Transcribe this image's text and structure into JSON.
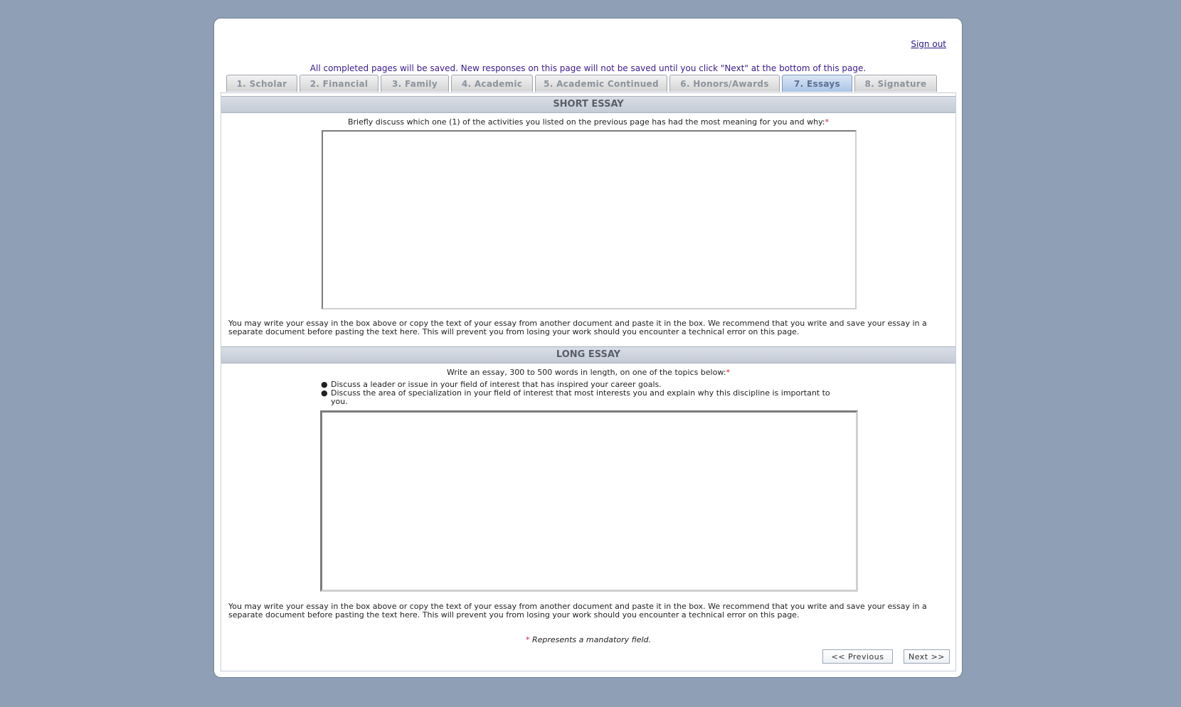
{
  "header": {
    "sign_out": "Sign out",
    "notice": "All completed pages will be saved. New responses on this page will not be saved until you click \"Next\" at the bottom of this page."
  },
  "tabs": [
    {
      "label": "1. Scholar",
      "active": false
    },
    {
      "label": "2. Financial",
      "active": false
    },
    {
      "label": "3. Family",
      "active": false
    },
    {
      "label": "4. Academic",
      "active": false
    },
    {
      "label": "5. Academic Continued",
      "active": false
    },
    {
      "label": "6. Honors/Awards",
      "active": false
    },
    {
      "label": "7. Essays",
      "active": true
    },
    {
      "label": "8. Signature",
      "active": false
    }
  ],
  "short_essay": {
    "title": "SHORT ESSAY",
    "prompt": "Briefly discuss which one (1) of the activities you listed on the previous page has had the most meaning for you and why:",
    "required_mark": "*",
    "value": "",
    "help": "You may write your essay in the box above or copy the text of your essay from another document and paste it in the box. We recommend that you write and save your essay in a separate document before pasting the text here. This will prevent you from losing your work should you encounter a technical error on this page."
  },
  "long_essay": {
    "title": "LONG ESSAY",
    "prompt": "Write an essay, 300 to 500 words in length, on one of the topics below:",
    "required_mark": "*",
    "bullet_symbol": "●",
    "topics": [
      "Discuss a leader or issue in your field of interest that has inspired your career goals.",
      "Discuss the area of specialization in your field of interest that most interests you and explain why this discipline is important to you."
    ],
    "value": "",
    "help": "You may write your essay in the box above or copy the text of your essay from another document and paste it in the box. We recommend that you write and save your essay in a separate document before pasting the text here. This will prevent you from losing your work should you encounter a technical error on this page."
  },
  "footer": {
    "mandatory_mark": "*",
    "mandatory_text": "Represents a mandatory field.",
    "previous_label": "<< Previous",
    "next_label": "Next >>"
  },
  "colors": {
    "background": "#8fa0b6",
    "required": "#d21f3c",
    "active_tab": "#a9c4e6"
  }
}
